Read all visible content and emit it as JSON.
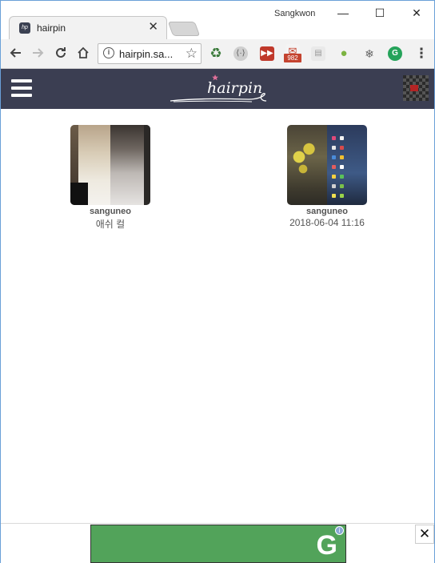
{
  "browser": {
    "tab_title": "hairpin",
    "tab_favicon_text": "hp",
    "tab_close": "✕",
    "profile_name": "Sangkwon",
    "minimize": "—",
    "maximize": "☐",
    "close": "✕",
    "url": "hairpin.sa...",
    "mail_badge": "982",
    "extension_icons": [
      "recycle-icon",
      "code-icon",
      "fastforward-icon",
      "gmail-icon",
      "reader-icon",
      "android-icon",
      "snowflake-icon",
      "grammarly-icon"
    ]
  },
  "site": {
    "logo_text": "hairpin",
    "colors": {
      "header": "#3b3e52",
      "logo_star": "#e0709a"
    }
  },
  "posts": [
    {
      "user": "sanguneo",
      "caption": "애쉬 컬"
    },
    {
      "user": "sanguneo",
      "caption": "2018-06-04 11:16"
    }
  ],
  "ad": {
    "logo_letter": "G",
    "info": "i",
    "close": "✕",
    "color": "#52a35a"
  }
}
